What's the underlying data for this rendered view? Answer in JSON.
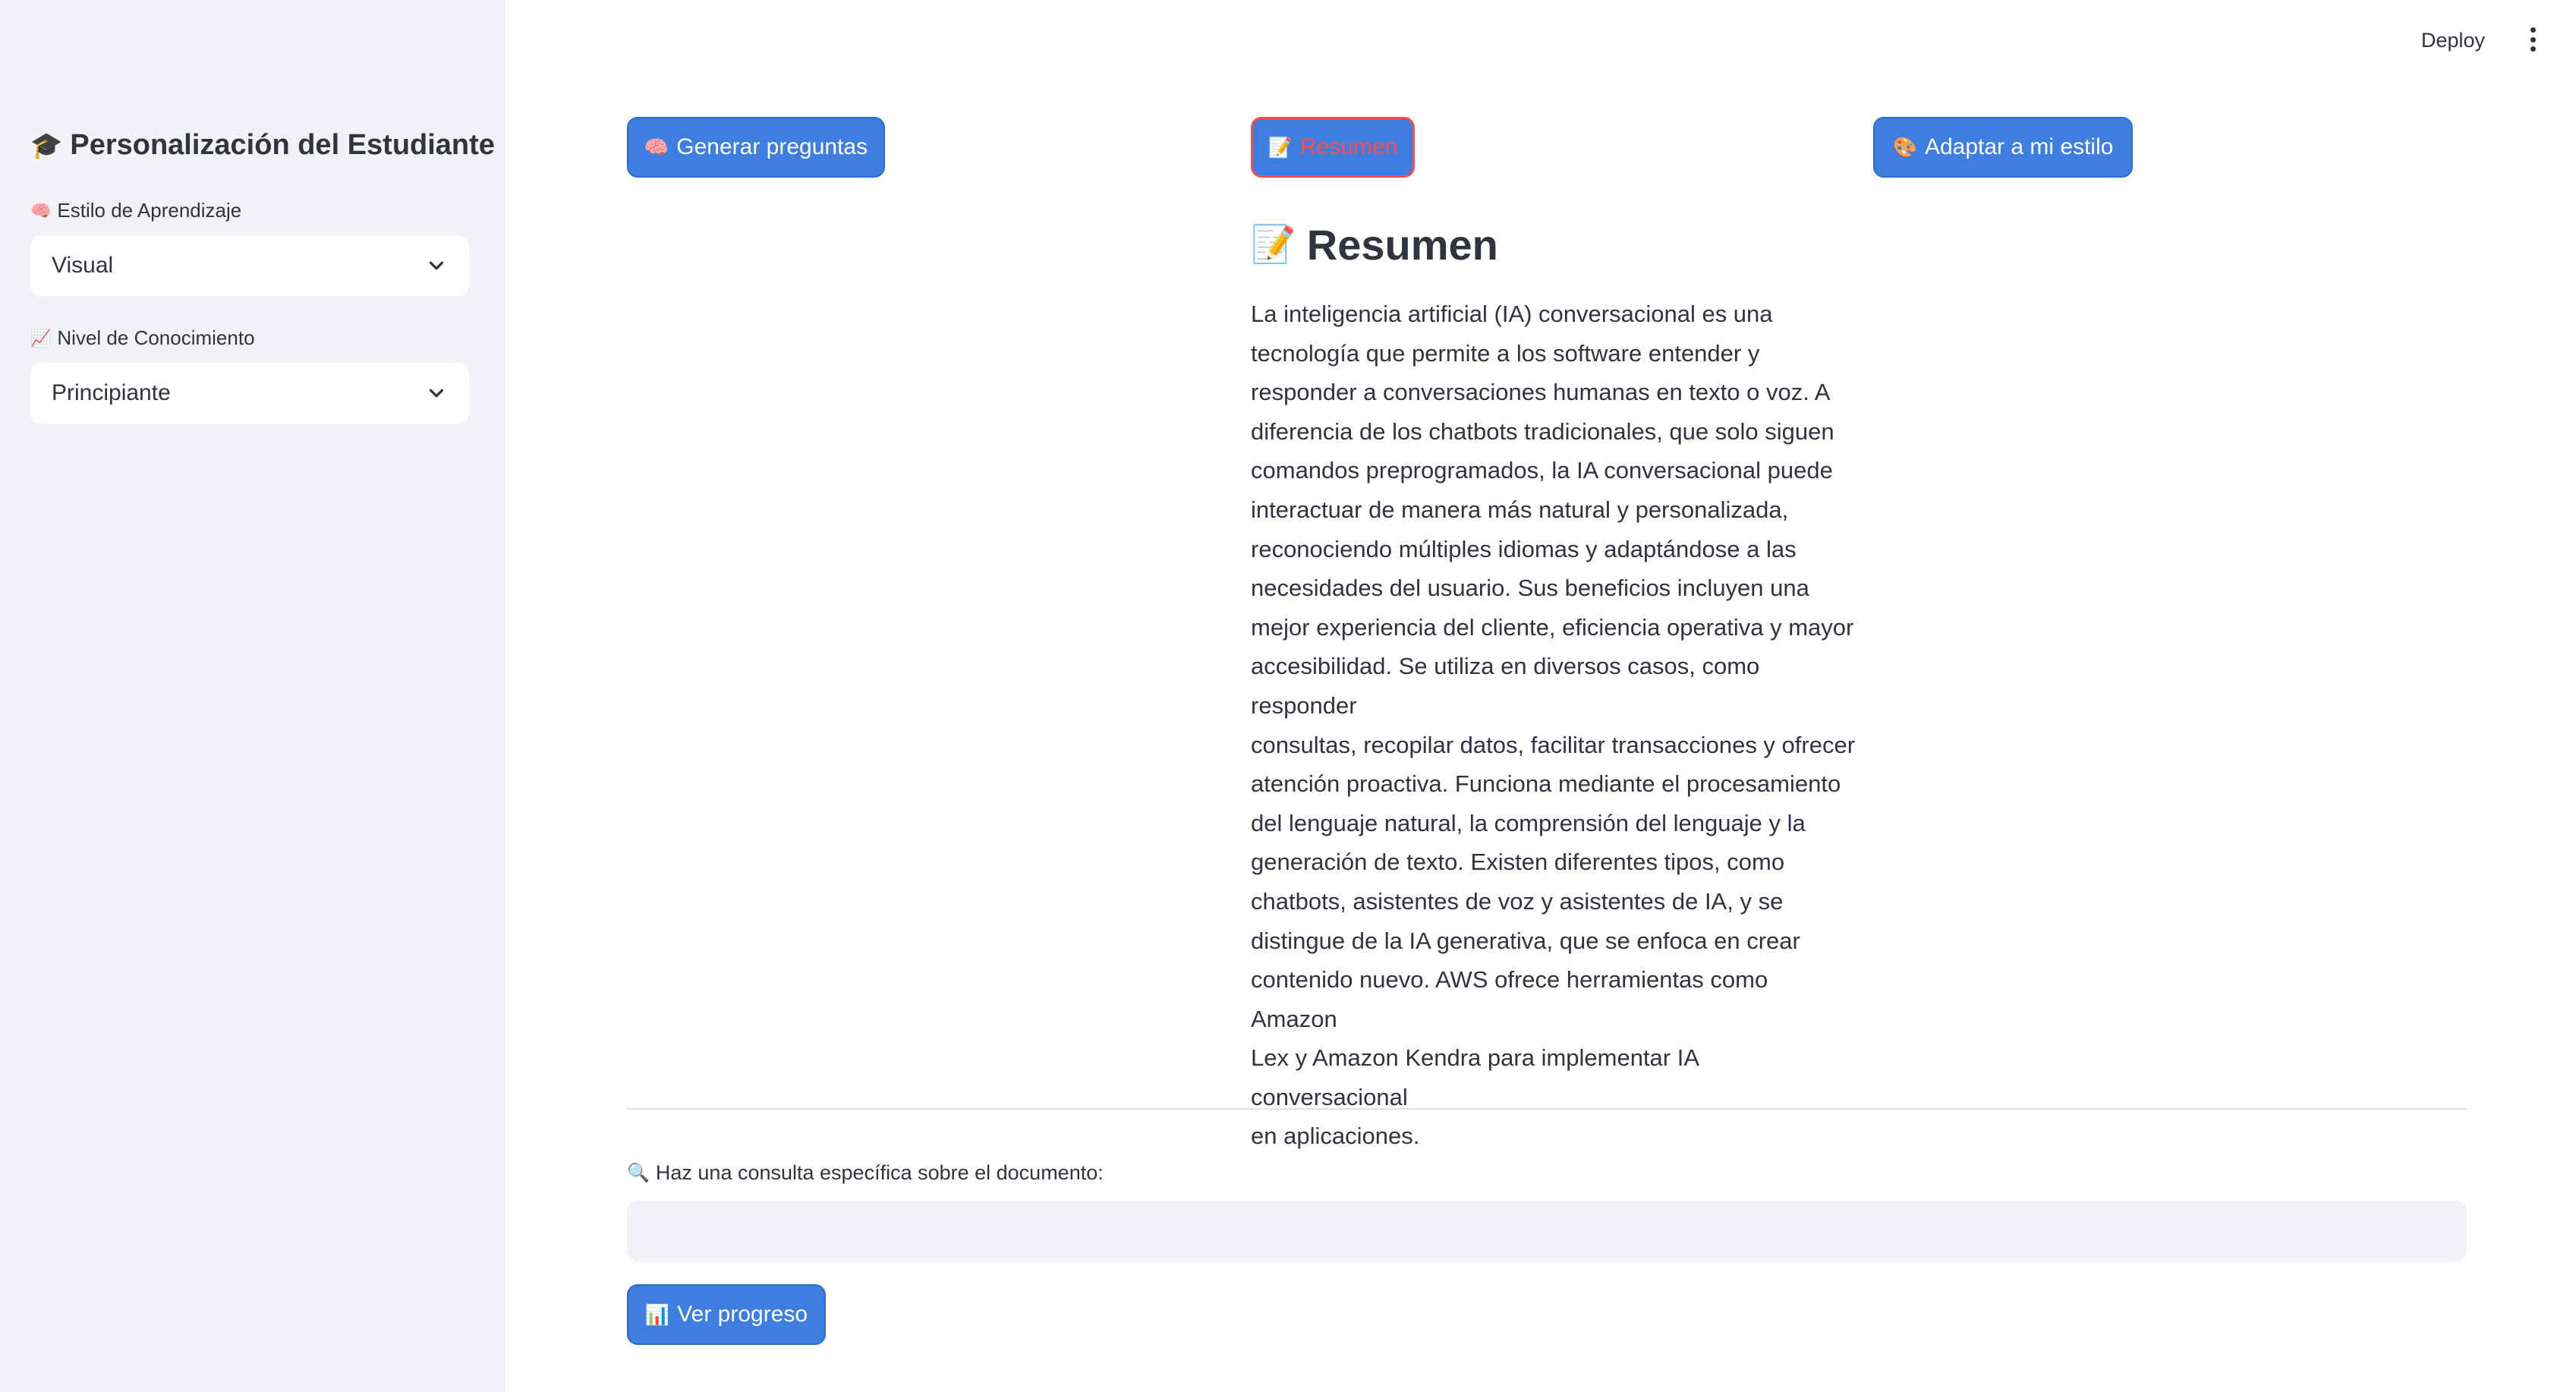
{
  "header": {
    "deploy_label": "Deploy",
    "menu_icon": "kebab-menu-icon"
  },
  "sidebar": {
    "title": "Personalización del Estudiante",
    "title_icon": "🎓",
    "learning_style": {
      "label": "Estilo de Aprendizaje",
      "icon": "🧠",
      "value": "Visual"
    },
    "knowledge_level": {
      "label": "Nivel de Conocimiento",
      "icon": "📈",
      "value": "Principiante"
    }
  },
  "actions": {
    "generate_questions": {
      "icon": "🧠",
      "label": "Generar preguntas"
    },
    "summary": {
      "icon": "📝",
      "label": "Resumen"
    },
    "adapt_style": {
      "icon": "🎨",
      "label": "Adaptar a mi estilo"
    }
  },
  "summary": {
    "icon": "📝",
    "heading": "Resumen",
    "lines": [
      "La inteligencia artificial (IA) conversacional es una",
      "tecnología que permite a los software entender y",
      "responder a conversaciones humanas en texto o voz. A",
      "diferencia de los chatbots tradicionales, que solo siguen",
      "comandos preprogramados, la IA conversacional puede",
      "interactuar de manera más natural y personalizada,",
      "reconociendo múltiples idiomas y adaptándose a las",
      "necesidades del usuario. Sus beneficios incluyen una",
      "mejor experiencia del cliente, eficiencia operativa y mayor",
      "accesibilidad. Se utiliza en diversos casos, como responder",
      "consultas, recopilar datos, facilitar transacciones y ofrecer",
      "atención proactiva. Funciona mediante el procesamiento",
      "del lenguaje natural, la comprensión del lenguaje y la",
      "generación de texto. Existen diferentes tipos, como",
      "chatbots, asistentes de voz y asistentes de IA, y se",
      "distingue de la IA generativa, que se enfoca en crear",
      "contenido nuevo. AWS ofrece herramientas como Amazon",
      "Lex y Amazon Kendra para implementar IA conversacional",
      "en aplicaciones."
    ]
  },
  "query": {
    "icon": "🔍",
    "label": "Haz una consulta específica sobre el documento:",
    "value": "",
    "placeholder": ""
  },
  "progress": {
    "icon": "📊",
    "label": "Ver progreso"
  },
  "colors": {
    "primary_button": "#3d7ee0",
    "active_accent": "#ff4b4b",
    "sidebar_bg": "#f0f2f6",
    "text": "#31333f"
  }
}
